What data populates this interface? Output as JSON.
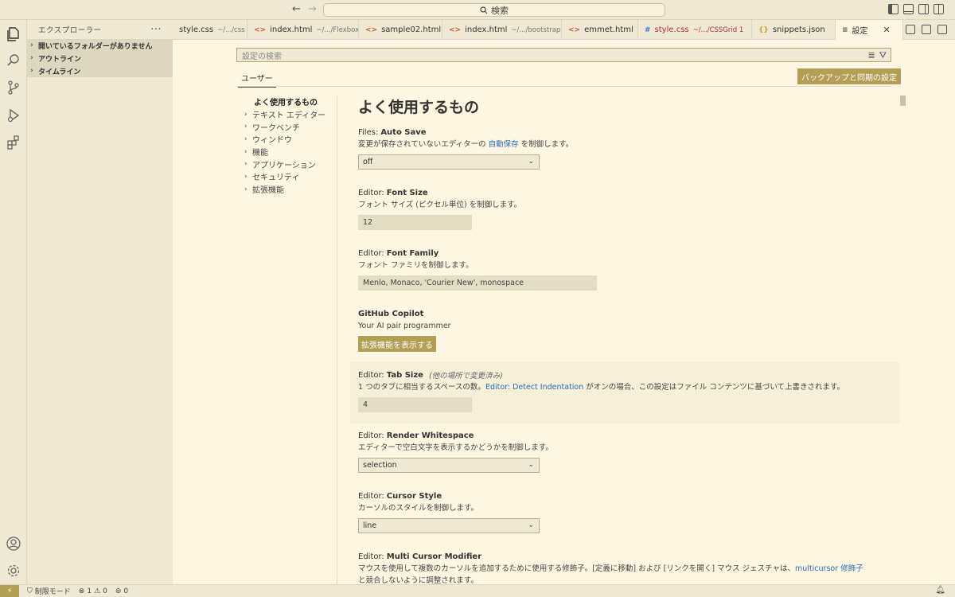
{
  "titlebar": {
    "back": "←",
    "forward": "→",
    "search_label": "検索"
  },
  "sidebar": {
    "title": "エクスプローラー",
    "sections": [
      "開いているフォルダーがありません",
      "アウトライン",
      "タイムライン"
    ]
  },
  "tabs": [
    {
      "file": "style.css",
      "desc": "~/.../css",
      "icon": ""
    },
    {
      "file": "index.html",
      "desc": "~/.../Flexbox",
      "icon": "<>"
    },
    {
      "file": "sample02.html",
      "desc": "",
      "icon": "<>"
    },
    {
      "file": "index.html",
      "desc": "~/.../bootstrap",
      "icon": "<>"
    },
    {
      "file": "emmet.html",
      "desc": "",
      "icon": "<>"
    },
    {
      "file": "style.css",
      "desc": "~/.../CSSGrid 1",
      "icon": "#"
    },
    {
      "file": "snippets.json",
      "desc": "",
      "icon": "{}"
    },
    {
      "file": "設定",
      "desc": "",
      "icon": "≡"
    }
  ],
  "settings_editor": {
    "search_placeholder": "設定の検索",
    "scope_tab": "ユーザー",
    "sync_button": "バックアップと同期の設定",
    "toc": {
      "active": "よく使用するもの",
      "items": [
        "テキスト エディター",
        "ワークベンチ",
        "ウィンドウ",
        "機能",
        "アプリケーション",
        "セキュリティ",
        "拡張機能"
      ]
    },
    "category_title": "よく使用するもの",
    "settings": {
      "autosave": {
        "cat": "Files:",
        "name": "Auto Save",
        "desc_pre": "変更が保存されていないエディターの ",
        "link": "自動保存",
        "desc_post": " を制御します。",
        "value": "off"
      },
      "fontsize": {
        "cat": "Editor:",
        "name": "Font Size",
        "desc": "フォント サイズ (ピクセル単位) を制御します。",
        "value": "12"
      },
      "fontfamily": {
        "cat": "Editor:",
        "name": "Font Family",
        "desc": "フォント ファミリを制御します。",
        "value": "Menlo, Monaco, 'Courier New', monospace"
      },
      "copilot": {
        "name": "GitHub Copilot",
        "desc": "Your AI pair programmer",
        "button": "拡張機能を表示する"
      },
      "tabsize": {
        "cat": "Editor:",
        "name": "Tab Size",
        "modified": "(他の場所で変更済み)",
        "desc_pre": "1 つのタブに相当するスペースの数。",
        "link": "Editor: Detect Indentation",
        "desc_post": " がオンの場合、この設定はファイル コンテンツに基づいて上書きされます。",
        "value": "4"
      },
      "whitespace": {
        "cat": "Editor:",
        "name": "Render Whitespace",
        "desc": "エディターで空白文字を表示するかどうかを制御します。",
        "value": "selection"
      },
      "cursor": {
        "cat": "Editor:",
        "name": "Cursor Style",
        "desc": "カーソルのスタイルを制御します。",
        "value": "line"
      },
      "multicursor": {
        "cat": "Editor:",
        "name": "Multi Cursor Modifier",
        "desc_pre": "マウスを使用して複数のカーソルを追加するために使用する修飾子。[定義に移動] および [リンクを開く] マウス ジェスチャは、",
        "link": "multicursor 修飾子",
        "desc_post": " と競合しないように調整されます。"
      }
    }
  },
  "statusbar": {
    "remote_icon": "⚡",
    "restricted": "制限モード",
    "errors": "1",
    "warnings": "0",
    "ports": "0"
  }
}
